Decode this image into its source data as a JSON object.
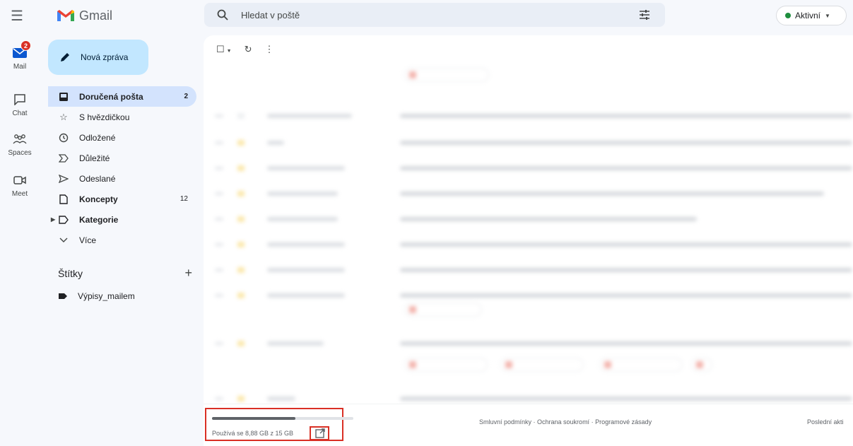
{
  "app": {
    "name": "Gmail"
  },
  "search": {
    "placeholder": "Hledat v poště"
  },
  "status": {
    "label": "Aktivní"
  },
  "rail": {
    "mail": {
      "label": "Mail",
      "badge": "2"
    },
    "chat": {
      "label": "Chat"
    },
    "spaces": {
      "label": "Spaces"
    },
    "meet": {
      "label": "Meet"
    }
  },
  "compose": {
    "label": "Nová zpráva"
  },
  "nav": {
    "items": [
      {
        "label": "Doručená pošta",
        "count": "2",
        "icon": "inbox-icon"
      },
      {
        "label": "S hvězdičkou",
        "count": "",
        "icon": "star-icon"
      },
      {
        "label": "Odložené",
        "count": "",
        "icon": "clock-icon"
      },
      {
        "label": "Důležité",
        "count": "",
        "icon": "important-icon"
      },
      {
        "label": "Odeslané",
        "count": "",
        "icon": "send-icon"
      },
      {
        "label": "Koncepty",
        "count": "12",
        "icon": "draft-icon"
      },
      {
        "label": "Kategorie",
        "count": "",
        "icon": "label-outline-icon"
      },
      {
        "label": "Více",
        "count": "",
        "icon": "chevron-down-icon"
      }
    ]
  },
  "labels": {
    "heading": "Štítky",
    "items": [
      {
        "label": "Výpisy_mailem",
        "icon": "label-icon"
      }
    ]
  },
  "footer": {
    "storage_text": "Používá se 8,88 GB z 15 GB",
    "storage_used_fraction": 0.592,
    "terms": "Smluvní podmínky",
    "privacy": "Ochrana soukromí",
    "program": "Programové zásady",
    "last_activity": "Poslední akti"
  },
  "colors": {
    "accent": "#c2e7ff",
    "active_nav": "#d3e3fd",
    "badge": "#d93025",
    "status_dot": "#1e8e3e",
    "highlight_box": "#d93025"
  }
}
